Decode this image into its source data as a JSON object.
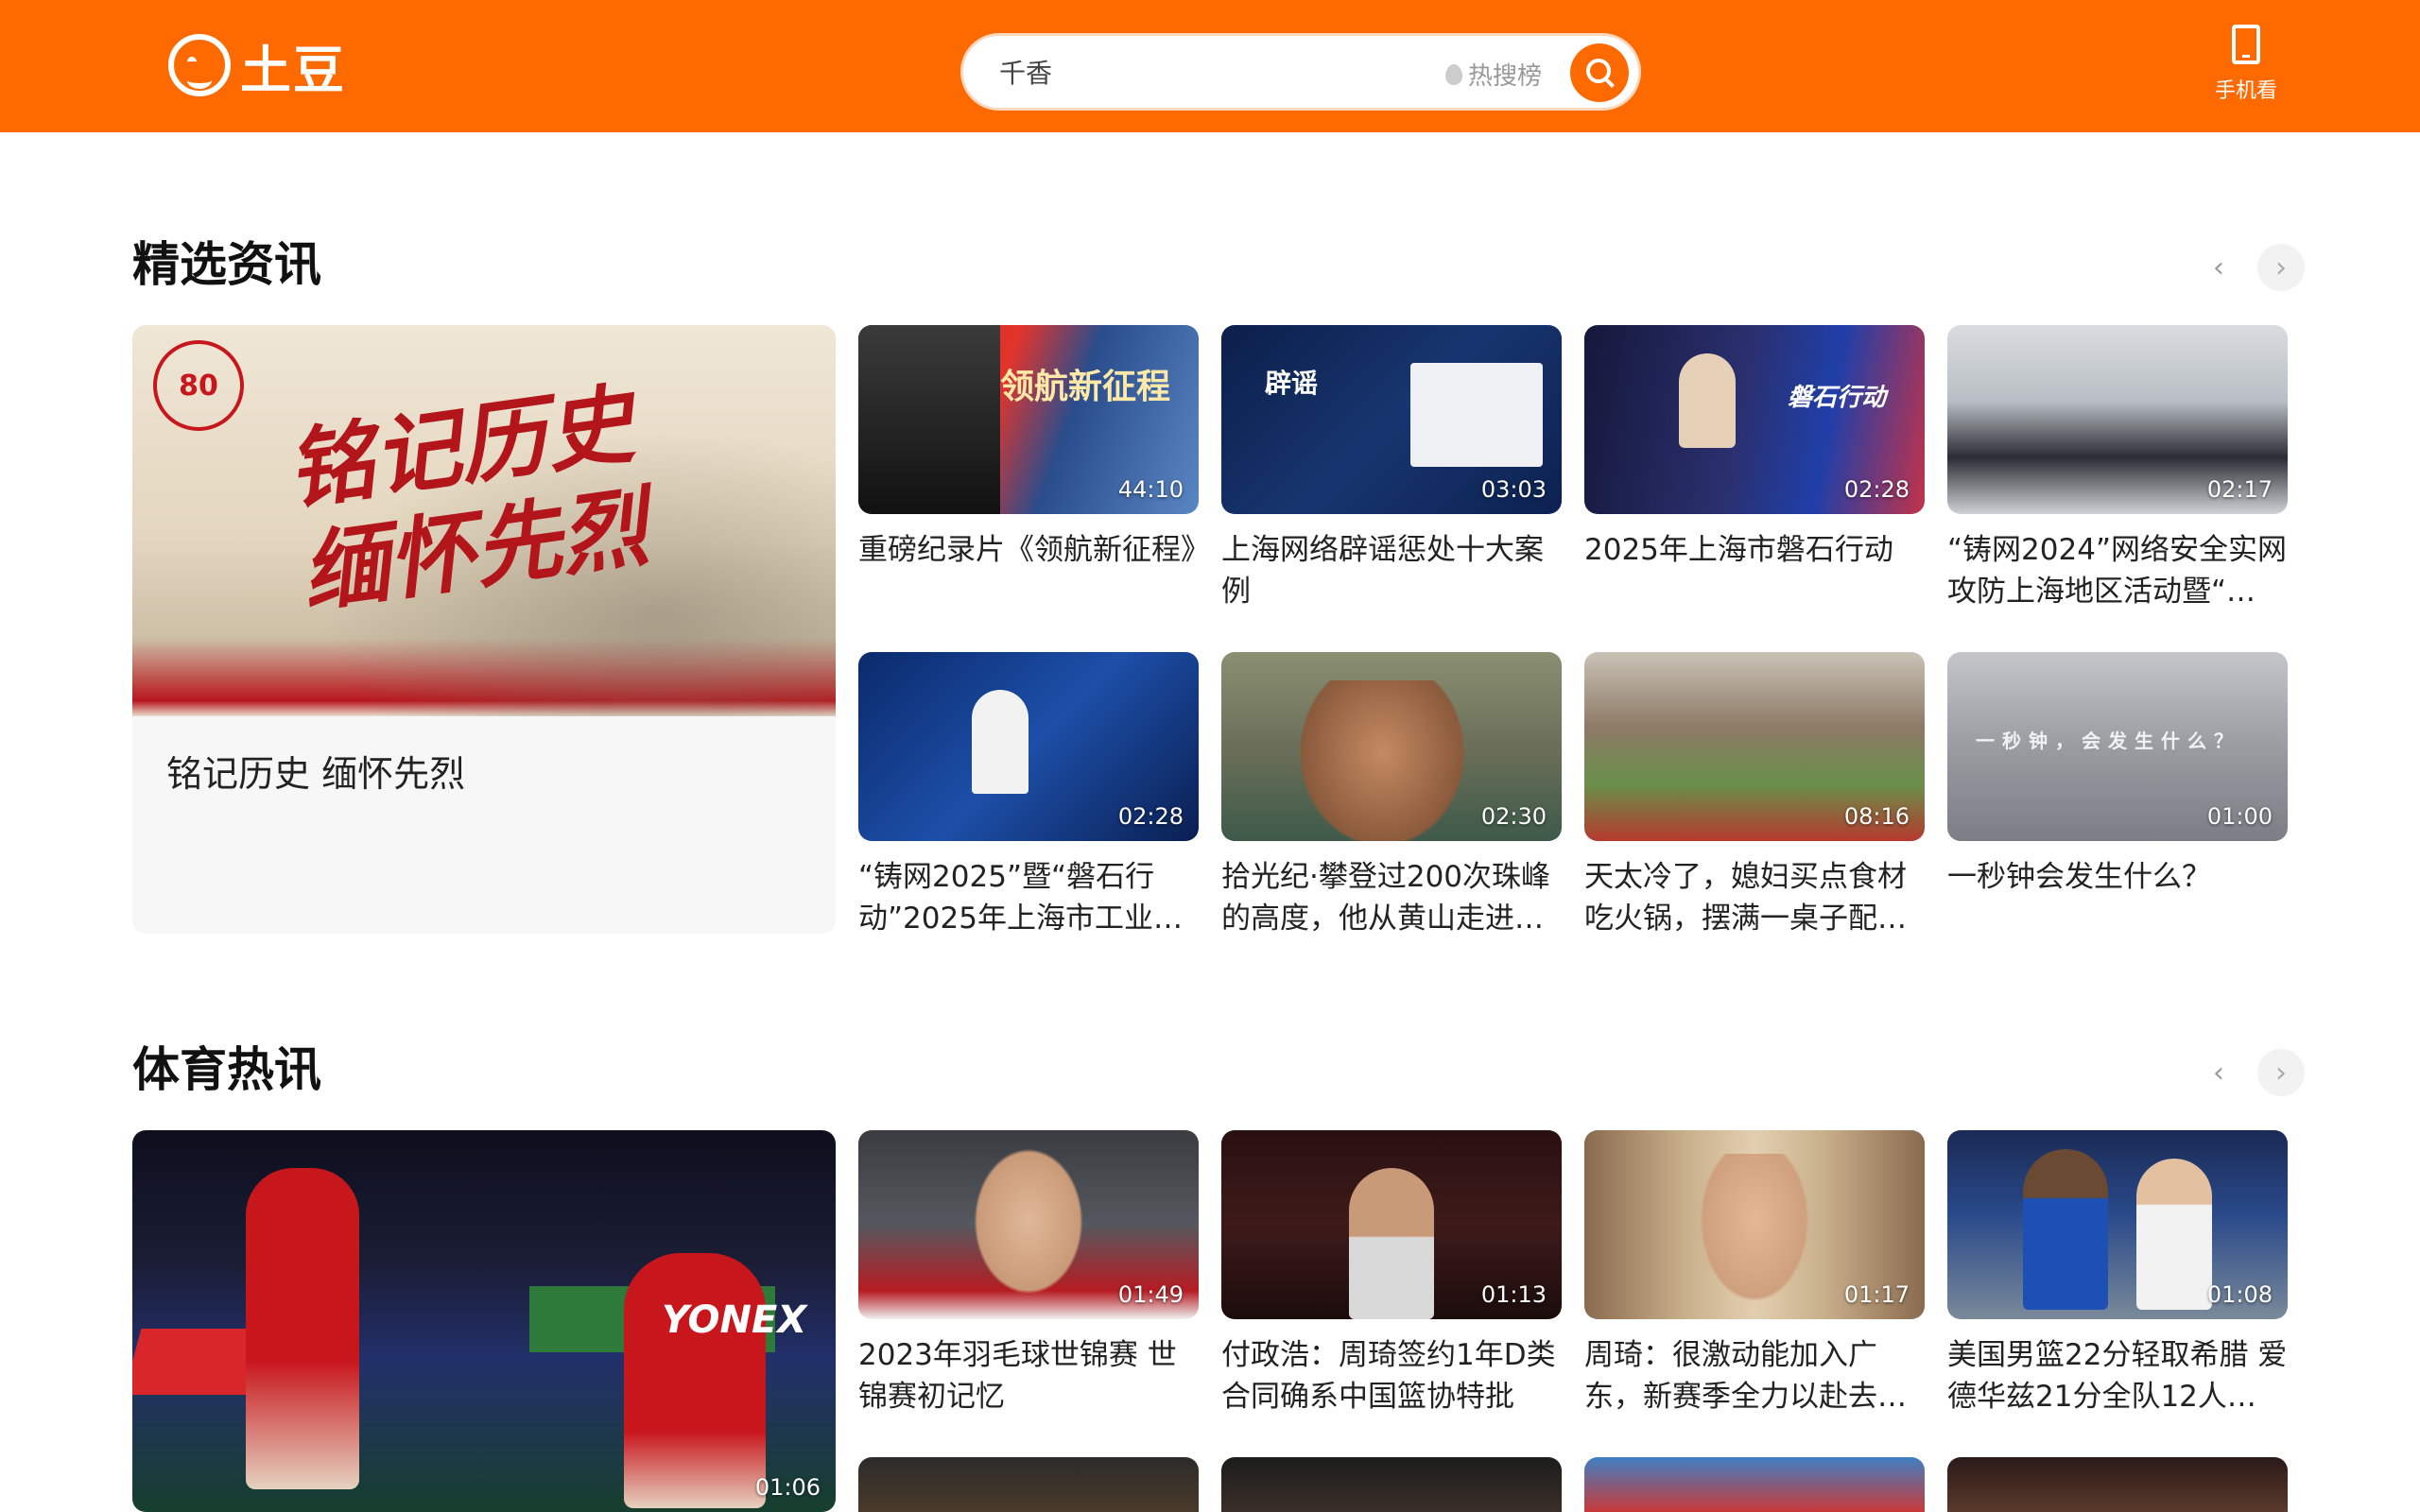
{
  "header": {
    "logo_text": "土豆",
    "search_placeholder": "千香",
    "hot_rank_label": "热搜榜",
    "mobile_label": "手机看"
  },
  "sections": [
    {
      "title": "精选资讯",
      "featured": {
        "title": "铭记历史 缅怀先烈",
        "art_text": "铭记历史缅怀先烈",
        "badge": "80"
      },
      "cards": [
        {
          "title": "重磅纪录片《领航新征程》",
          "duration": "44:10",
          "art_text": "领航新征程"
        },
        {
          "title": "上海网络辟谣惩处十大案例",
          "duration": "03:03",
          "art_text": "辟谣"
        },
        {
          "title": "2025年上海市磐石行动",
          "duration": "02:28",
          "art_text": "磐石行动"
        },
        {
          "title": "“铸网2024”网络安全实网攻防上海地区活动暨“…",
          "duration": "02:17"
        },
        {
          "title": "“铸网2025”暨“磐石行动”2025年上海市工业…",
          "duration": "02:28"
        },
        {
          "title": "拾光纪·攀登过200次珠峰的高度，他从黄山走进…",
          "duration": "02:30"
        },
        {
          "title": "天太冷了，媳妇买点食材吃火锅，摆满一桌子配…",
          "duration": "08:16"
        },
        {
          "title": "一秒钟会发生什么？",
          "duration": "01:00",
          "art_text": "一秒钟，会发生什么？"
        }
      ]
    },
    {
      "title": "体育热讯",
      "featured": {
        "duration": "01:06",
        "art_text": "YONEX"
      },
      "cards": [
        {
          "title": "2023年羽毛球世锦赛 世锦赛初记忆",
          "duration": "01:49"
        },
        {
          "title": "付政浩：周琦签约1年D类合同确系中国篮协特批",
          "duration": "01:13"
        },
        {
          "title": "周琦：很激动能加入广东，新赛季全力以赴去…",
          "duration": "01:17"
        },
        {
          "title": "美国男篮22分轻取希腊 爱德华兹21分全队12人…",
          "duration": "01:08"
        }
      ]
    }
  ],
  "colors": {
    "brand": "#ff6a00",
    "text": "#222222",
    "card_bg": "#f7f7f7"
  }
}
